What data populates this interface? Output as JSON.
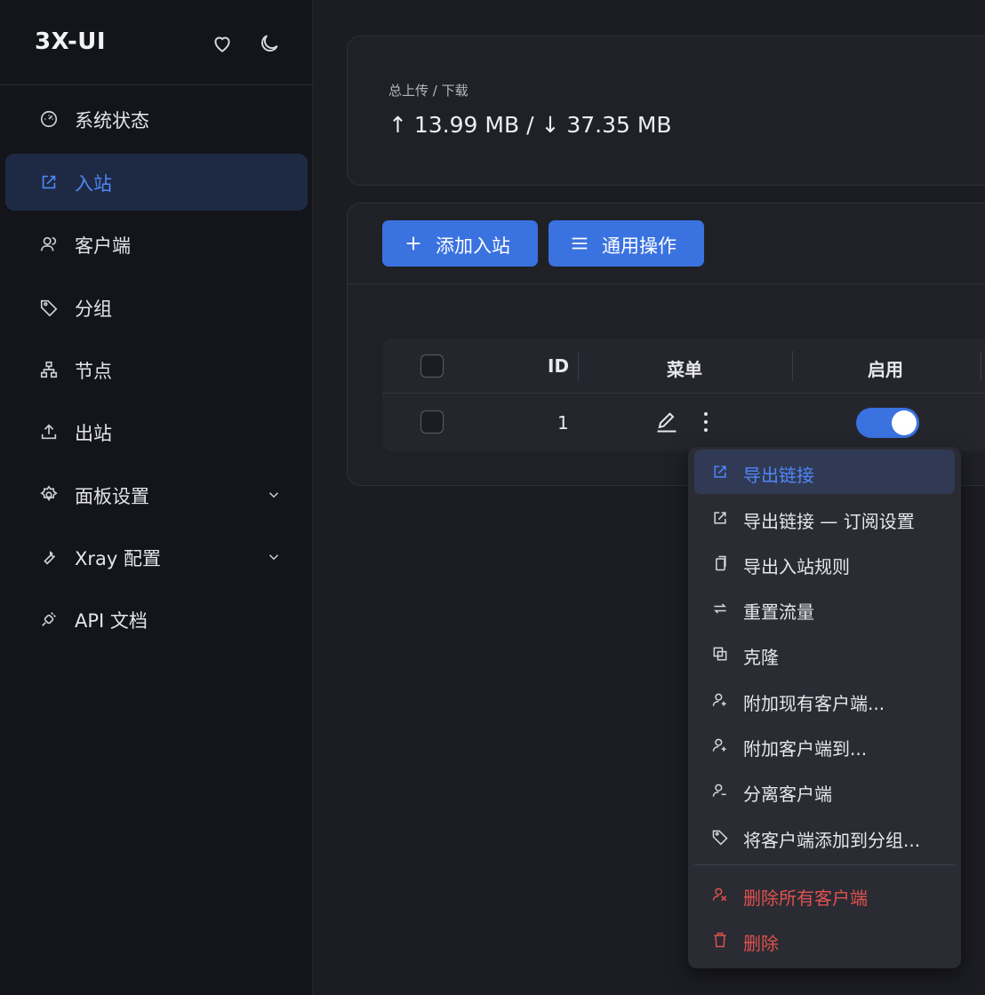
{
  "brand": {
    "title": "3X-UI",
    "heart_icon": "heart-icon",
    "theme_icon": "moon-icon"
  },
  "sidebar": {
    "items": [
      {
        "label": "系统状态",
        "icon": "dashboard-gauge-icon"
      },
      {
        "label": "入站",
        "icon": "external-link-icon",
        "active": true
      },
      {
        "label": "客户端",
        "icon": "users-icon"
      },
      {
        "label": "分组",
        "icon": "tag-icon"
      },
      {
        "label": "节点",
        "icon": "cluster-icon"
      },
      {
        "label": "出站",
        "icon": "upload-icon"
      },
      {
        "label": "面板设置",
        "icon": "gear-icon",
        "expandable": true
      },
      {
        "label": "Xray 配置",
        "icon": "wrench-icon",
        "expandable": true
      },
      {
        "label": "API 文档",
        "icon": "plug-icon"
      }
    ]
  },
  "stats": {
    "label": "总上传 / 下载",
    "upload": "13.99 MB",
    "download": "37.35 MB",
    "value": "↑ 13.99 MB / ↓ 37.35 MB"
  },
  "toolbar": {
    "add_inbound": "添加入站",
    "general_actions": "通用操作"
  },
  "table": {
    "headers": {
      "id": "ID",
      "menu": "菜单",
      "enable": "启用"
    },
    "rows": [
      {
        "id": "1",
        "enabled": true
      }
    ]
  },
  "dropdown": {
    "items": [
      {
        "label": "导出链接",
        "icon": "export-icon",
        "state": "hover"
      },
      {
        "label": "导出链接 — 订阅设置",
        "icon": "export-icon"
      },
      {
        "label": "导出入站规则",
        "icon": "copy-icon"
      },
      {
        "label": "重置流量",
        "icon": "swap-icon"
      },
      {
        "label": "克隆",
        "icon": "clone-icon"
      },
      {
        "label": "附加现有客户端...",
        "icon": "user-add-icon"
      },
      {
        "label": "附加客户端到...",
        "icon": "user-add-icon"
      },
      {
        "label": "分离客户端",
        "icon": "user-remove-icon"
      },
      {
        "label": "将客户端添加到分组...",
        "icon": "tag-icon"
      },
      {
        "label": "删除所有客户端",
        "icon": "user-delete-icon",
        "danger": true
      },
      {
        "label": "删除",
        "icon": "trash-icon",
        "danger": true
      }
    ]
  },
  "colors": {
    "accent": "#3a72e0",
    "active_text": "#4f86f7",
    "danger": "#e0514f",
    "sidebar_bg": "#14151a",
    "main_bg": "#1c1d23"
  }
}
